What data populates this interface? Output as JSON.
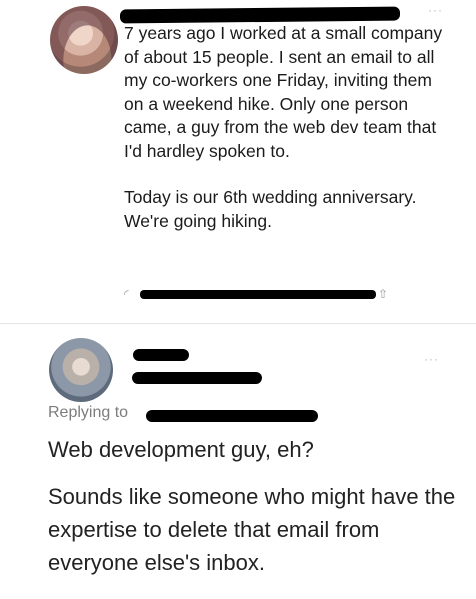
{
  "post": {
    "paragraphs": [
      "7 years ago I worked at a small company of about 15 people. I sent an email to all my co-workers one Friday, inviting them on a weekend hike. Only one person came, a guy from the web dev team that I'd hardley spoken to.",
      "Today is our 6th wedding anniversary. We're going hiking."
    ],
    "more_icon": "more-horizontal-icon"
  },
  "reply": {
    "replying_to_label": "Replying to",
    "lines": [
      "Web development guy, eh?",
      "Sounds like someone who might have the expertise to delete that email from everyone else's inbox."
    ],
    "more_icon": "more-horizontal-icon"
  }
}
